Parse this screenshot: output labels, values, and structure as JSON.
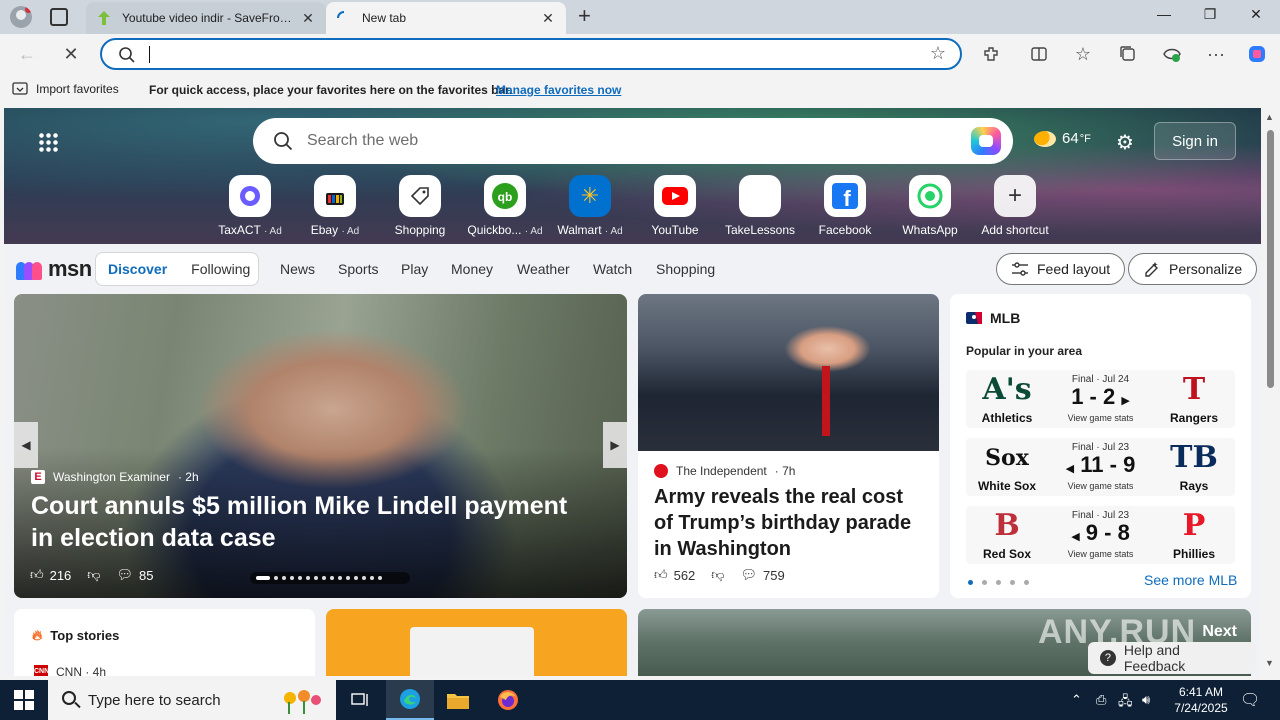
{
  "browser": {
    "tabs": [
      {
        "title": "Youtube video indir - SaveFrom.net",
        "active": false
      },
      {
        "title": "New tab",
        "active": true
      }
    ],
    "address": {
      "value": "",
      "placeholder": ""
    }
  },
  "favorites_bar": {
    "import_label": "Import favorites",
    "hint": "For quick access, place your favorites here on the favorites bar.",
    "manage_link": "Manage favorites now"
  },
  "hero": {
    "search_placeholder": "Search the web",
    "weather_temp": "64",
    "weather_unit": "°F",
    "signin_label": "Sign in",
    "shortcuts": [
      {
        "label": "TaxACT",
        "ad": "· Ad",
        "icon": "taxact-icon"
      },
      {
        "label": "Ebay",
        "ad": "· Ad",
        "icon": "ebay-icon"
      },
      {
        "label": "Shopping",
        "ad": "",
        "icon": "shopping-tag-icon"
      },
      {
        "label": "Quickbo...",
        "ad": "· Ad",
        "icon": "quickbooks-icon"
      },
      {
        "label": "Walmart",
        "ad": "· Ad",
        "icon": "walmart-icon"
      },
      {
        "label": "YouTube",
        "ad": "",
        "icon": "youtube-icon"
      },
      {
        "label": "TakeLessons",
        "ad": "",
        "icon": "takelessons-icon"
      },
      {
        "label": "Facebook",
        "ad": "",
        "icon": "facebook-icon"
      },
      {
        "label": "WhatsApp",
        "ad": "",
        "icon": "whatsapp-icon"
      },
      {
        "label": "Add shortcut",
        "ad": "",
        "icon": "plus-icon"
      }
    ]
  },
  "msn_nav": {
    "logo": "msn",
    "tab_discover": "Discover",
    "tab_following": "Following",
    "links": [
      "News",
      "Sports",
      "Play",
      "Money",
      "Weather",
      "Watch",
      "Shopping"
    ],
    "feed_layout": "Feed layout",
    "personalize": "Personalize"
  },
  "hero_story": {
    "source": "Washington Examiner",
    "age": "· 2h",
    "headline": "Court annuls $5 million Mike Lindell payment in election data case",
    "likes": "216",
    "comments": "85"
  },
  "story2": {
    "source": "The Independent",
    "age": "· 7h",
    "headline": "Army reveals the real cost of Trump’s birthday parade in Washington",
    "likes": "562",
    "comments": "759"
  },
  "mlb": {
    "title": "MLB",
    "subtitle": "Popular in your area",
    "games": [
      {
        "status": "Final · Jul 24",
        "score": "1 - 2",
        "winner": "right",
        "left_team": "Athletics",
        "right_team": "Rangers",
        "left_logo": "A's",
        "right_logo": "T",
        "link": "View game stats",
        "left_color": "#0b4a36",
        "right_color": "#c0111f"
      },
      {
        "status": "Final · Jul 23",
        "score": "11 - 9",
        "winner": "left",
        "left_team": "White Sox",
        "right_team": "Rays",
        "left_logo": "Sox",
        "right_logo": "TB",
        "link": "View game stats",
        "left_color": "#111111",
        "right_color": "#092c5c"
      },
      {
        "status": "Final · Jul 23",
        "score": "9 - 8",
        "winner": "left",
        "left_team": "Red Sox",
        "right_team": "Phillies",
        "left_logo": "B",
        "right_logo": "P",
        "link": "View game stats",
        "left_color": "#0c2340",
        "right_color": "#284898"
      }
    ],
    "see_more": "See more MLB"
  },
  "lower": {
    "top_stories": "Top stories",
    "top_source": "CNN · 4h",
    "feedback": "Help and Feedback",
    "watermark": "ANY.RUN",
    "next_label": "Next"
  },
  "taskbar": {
    "search_placeholder": "Type here to search",
    "time": "6:41 AM",
    "date": "7/24/2025"
  },
  "colors": {
    "accent": "#0f6cbd",
    "taskbar": "#0e2036"
  }
}
